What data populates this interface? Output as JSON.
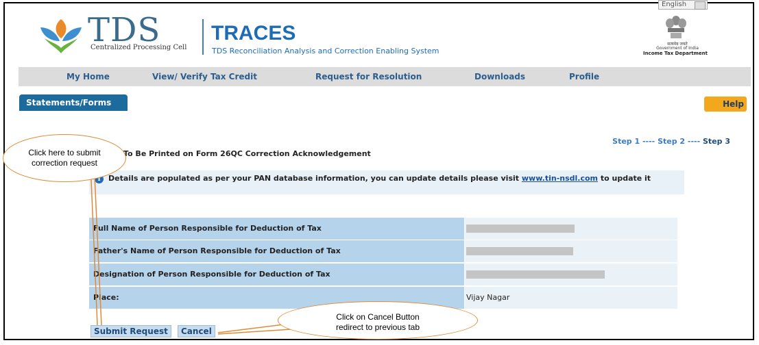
{
  "header": {
    "language": "English",
    "tds_title": "TDS",
    "tds_subtitle": "Centralized Processing Cell",
    "traces_title": "TRACES",
    "traces_subtitle": "TDS Reconciliation Analysis and Correction Enabling System",
    "gov_line1": "सत्यमेव जयते",
    "gov_line2": "Government of India",
    "gov_line3": "Income Tax Department"
  },
  "nav": {
    "items": [
      "My Home",
      "View/ Verify Tax Credit",
      "Request for Resolution",
      "Downloads",
      "Profile"
    ]
  },
  "tab_label": "Statements/Forms",
  "help_label": "Help",
  "steps": {
    "step1": "Step 1",
    "sep1": " ---- ",
    "step2": "Step 2",
    "sep2": " ---- ",
    "step3": "Step 3"
  },
  "section_title": "To Be Printed on Form 26QC Correction Acknowledgement",
  "info": {
    "text": "Details are populated as per your PAN database information, you can update details please visit ",
    "link": "www.tin-nsdl.com",
    "suffix": " to update it"
  },
  "rows": [
    {
      "label": "Full Name of Person Responsible for Deduction of Tax",
      "value": ""
    },
    {
      "label": "Father's Name of Person Responsible for Deduction of Tax",
      "value": ""
    },
    {
      "label": "Designation of Person Responsible for Deduction of Tax",
      "value": ""
    },
    {
      "label": "Place:",
      "value": "Vijay Nagar"
    }
  ],
  "buttons": {
    "submit": "Submit Request",
    "cancel": "Cancel"
  },
  "callouts": {
    "submit_note": "Click here to submit correction request",
    "cancel_note": "Click on  Cancel  Button redirect to previous  tab"
  },
  "colors": {
    "nav_text": "#2b5e8e",
    "tab_bg": "#1d6a9c",
    "help_bg": "#f2a71d",
    "label_bg": "#b6d3ec",
    "callout_border": "#e08a33"
  }
}
